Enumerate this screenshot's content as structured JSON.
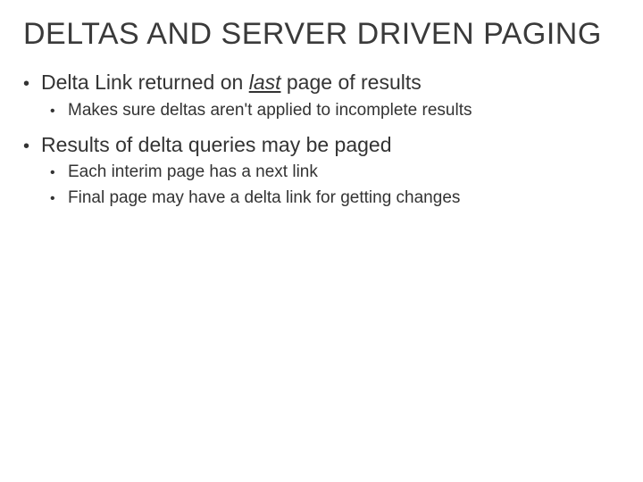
{
  "title": "DELTAS AND SERVER DRIVEN PAGING",
  "bullets": {
    "b0": {
      "pre": "Delta Link returned on ",
      "emph": "last",
      "post": " page of results"
    },
    "b0_0": "Makes sure deltas aren't applied to incomplete results",
    "b1": "Results of delta queries may be paged",
    "b1_0": "Each interim page has a next link",
    "b1_1": "Final page may have a delta link for getting changes"
  },
  "glyphs": {
    "bullet": "•"
  }
}
